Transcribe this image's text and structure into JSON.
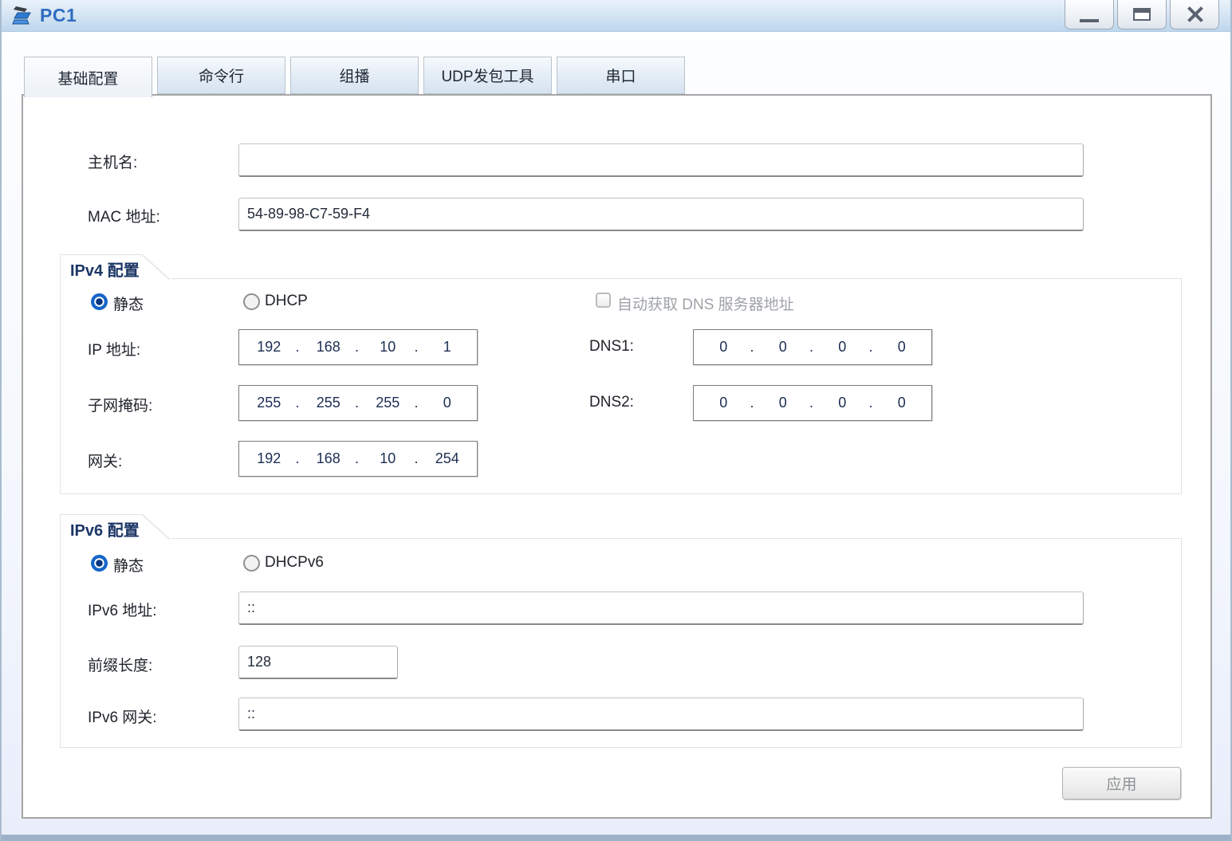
{
  "window": {
    "title": "PC1"
  },
  "icons": {
    "app": "pc-laptop-icon",
    "minimize": "minimize-icon",
    "maximize": "maximize-icon",
    "close": "close-icon"
  },
  "tabs": [
    {
      "label": "基础配置",
      "active": true
    },
    {
      "label": "命令行",
      "active": false
    },
    {
      "label": "组播",
      "active": false
    },
    {
      "label": "UDP发包工具",
      "active": false
    },
    {
      "label": "串口",
      "active": false
    }
  ],
  "form": {
    "hostname": {
      "label": "主机名:",
      "value": ""
    },
    "mac": {
      "label": "MAC 地址:",
      "value": "54-89-98-C7-59-F4"
    },
    "ipv4": {
      "group_label": "IPv4 配置",
      "static_label": "静态",
      "dhcp_label": "DHCP",
      "mode": "static",
      "dns_auto_label": "自动获取 DNS 服务器地址",
      "dns_auto_checked": false,
      "ip": {
        "label": "IP 地址:",
        "octets": [
          "192",
          "168",
          "10",
          "1"
        ]
      },
      "mask": {
        "label": "子网掩码:",
        "octets": [
          "255",
          "255",
          "255",
          "0"
        ]
      },
      "gateway": {
        "label": "网关:",
        "octets": [
          "192",
          "168",
          "10",
          "254"
        ]
      },
      "dns1": {
        "label": "DNS1:",
        "octets": [
          "0",
          "0",
          "0",
          "0"
        ]
      },
      "dns2": {
        "label": "DNS2:",
        "octets": [
          "0",
          "0",
          "0",
          "0"
        ]
      }
    },
    "ipv6": {
      "group_label": "IPv6 配置",
      "static_label": "静态",
      "dhcp_label": "DHCPv6",
      "mode": "static",
      "address": {
        "label": "IPv6 地址:",
        "value": "::"
      },
      "prefix": {
        "label": "前缀长度:",
        "value": "128"
      },
      "gateway": {
        "label": "IPv6 网关:",
        "value": "::"
      }
    },
    "apply_label": "应用"
  },
  "colors": {
    "accent_blue": "#1565c8",
    "title_text": "#2d6cc0",
    "titlebar_top": "#eaf2fa",
    "titlebar_bottom": "#bcd6ec",
    "panel_border": "#a6a6a6",
    "bottom_bar": "#9db2c8",
    "disabled_text": "#9fa3a8"
  }
}
